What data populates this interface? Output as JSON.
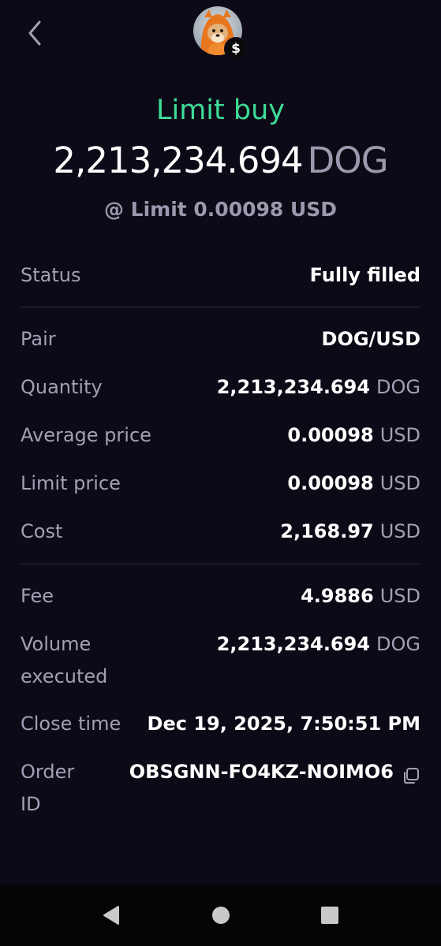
{
  "header": {
    "back_icon": "chevron-left-icon",
    "avatar": "dog-token-avatar",
    "badge_symbol": "$"
  },
  "order": {
    "type_label": "Limit buy",
    "amount": "2,213,234.694",
    "amount_unit": "DOG",
    "limit_line": "@ Limit 0.00098 USD"
  },
  "details": {
    "status": {
      "label": "Status",
      "value": "Fully filled"
    },
    "pair": {
      "label": "Pair",
      "value": "DOG/USD"
    },
    "quantity": {
      "label": "Quantity",
      "value": "2,213,234.694",
      "unit": "DOG"
    },
    "average_price": {
      "label": "Average price",
      "value": "0.00098",
      "unit": "USD"
    },
    "limit_price": {
      "label": "Limit price",
      "value": "0.00098",
      "unit": "USD"
    },
    "cost": {
      "label": "Cost",
      "value": "2,168.97",
      "unit": "USD"
    },
    "fee": {
      "label": "Fee",
      "value": "4.9886",
      "unit": "USD"
    },
    "volume_executed": {
      "label": "Volume executed",
      "value": "2,213,234.694",
      "unit": "DOG"
    },
    "close_time": {
      "label": "Close time",
      "value": "Dec 19, 2025, 7:50:51 PM"
    },
    "order_id": {
      "label": "Order ID",
      "value": "OBSGNN-FO4KZ-NOIMO6"
    }
  },
  "colors": {
    "background": "#0d0a17",
    "accent_green": "#3ddc97",
    "muted_text": "#a49fb5",
    "divider": "#2c2838"
  },
  "navbar": {
    "back": "triangle-back-icon",
    "home": "circle-home-icon",
    "recents": "square-recents-icon"
  }
}
